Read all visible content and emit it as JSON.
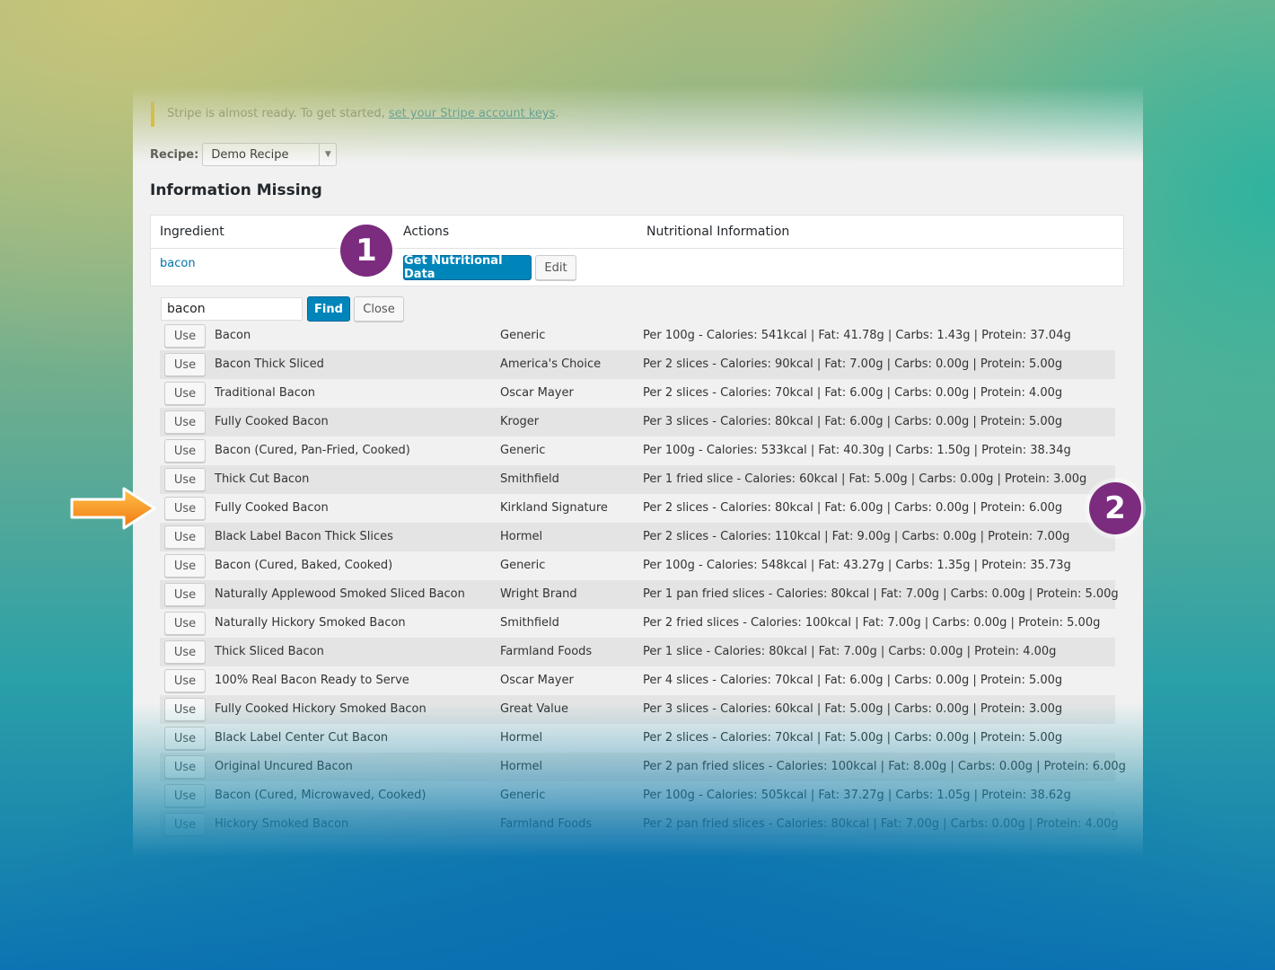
{
  "notice": {
    "text": "Stripe is almost ready. To get started, ",
    "link": "set your Stripe account keys",
    "end": "."
  },
  "recipe": {
    "label": "Recipe:",
    "selected": "Demo Recipe"
  },
  "heading": "Information Missing",
  "table": {
    "headers": [
      "Ingredient",
      "Actions",
      "Nutritional Information"
    ],
    "ingredient": "bacon",
    "get_button": "Get Nutritional Data",
    "edit_button": "Edit"
  },
  "search": {
    "value": "bacon",
    "find_label": "Find",
    "close_label": "Close"
  },
  "use_label": "Use",
  "results": [
    {
      "name": "Bacon",
      "brand": "Generic",
      "nutrition": "Per 100g - Calories: 541kcal | Fat: 41.78g | Carbs: 1.43g | Protein: 37.04g"
    },
    {
      "name": "Bacon Thick Sliced",
      "brand": "America's Choice",
      "nutrition": "Per 2 slices - Calories: 90kcal | Fat: 7.00g | Carbs: 0.00g | Protein: 5.00g"
    },
    {
      "name": "Traditional Bacon",
      "brand": "Oscar Mayer",
      "nutrition": "Per 2 slices - Calories: 70kcal | Fat: 6.00g | Carbs: 0.00g | Protein: 4.00g"
    },
    {
      "name": "Fully Cooked Bacon",
      "brand": "Kroger",
      "nutrition": "Per 3 slices - Calories: 80kcal | Fat: 6.00g | Carbs: 0.00g | Protein: 5.00g"
    },
    {
      "name": "Bacon (Cured, Pan-Fried, Cooked)",
      "brand": "Generic",
      "nutrition": "Per 100g - Calories: 533kcal | Fat: 40.30g | Carbs: 1.50g | Protein: 38.34g"
    },
    {
      "name": "Thick Cut Bacon",
      "brand": "Smithfield",
      "nutrition": "Per 1 fried slice - Calories: 60kcal | Fat: 5.00g | Carbs: 0.00g | Protein: 3.00g"
    },
    {
      "name": "Fully Cooked Bacon",
      "brand": "Kirkland Signature",
      "nutrition": "Per 2 slices - Calories: 80kcal | Fat: 6.00g | Carbs: 0.00g | Protein: 6.00g"
    },
    {
      "name": "Black Label Bacon Thick Slices",
      "brand": "Hormel",
      "nutrition": "Per 2 slices - Calories: 110kcal | Fat: 9.00g | Carbs: 0.00g | Protein: 7.00g"
    },
    {
      "name": "Bacon (Cured, Baked, Cooked)",
      "brand": "Generic",
      "nutrition": "Per 100g - Calories: 548kcal | Fat: 43.27g | Carbs: 1.35g | Protein: 35.73g"
    },
    {
      "name": "Naturally Applewood Smoked Sliced Bacon",
      "brand": "Wright Brand",
      "nutrition": "Per 1 pan fried slices - Calories: 80kcal | Fat: 7.00g | Carbs: 0.00g | Protein: 5.00g"
    },
    {
      "name": "Naturally Hickory Smoked Bacon",
      "brand": "Smithfield",
      "nutrition": "Per 2 fried slices - Calories: 100kcal | Fat: 7.00g | Carbs: 0.00g | Protein: 5.00g"
    },
    {
      "name": "Thick Sliced Bacon",
      "brand": "Farmland Foods",
      "nutrition": "Per 1 slice - Calories: 80kcal | Fat: 7.00g | Carbs: 0.00g | Protein: 4.00g"
    },
    {
      "name": "100% Real Bacon Ready to Serve",
      "brand": "Oscar Mayer",
      "nutrition": "Per 4 slices - Calories: 70kcal | Fat: 6.00g | Carbs: 0.00g | Protein: 5.00g"
    },
    {
      "name": "Fully Cooked Hickory Smoked Bacon",
      "brand": "Great Value",
      "nutrition": "Per 3 slices - Calories: 60kcal | Fat: 5.00g | Carbs: 0.00g | Protein: 3.00g"
    },
    {
      "name": "Black Label Center Cut Bacon",
      "brand": "Hormel",
      "nutrition": "Per 2 slices - Calories: 70kcal | Fat: 5.00g | Carbs: 0.00g | Protein: 5.00g"
    },
    {
      "name": "Original Uncured Bacon",
      "brand": "Hormel",
      "nutrition": "Per 2 pan fried slices - Calories: 100kcal | Fat: 8.00g | Carbs: 0.00g | Protein: 6.00g"
    },
    {
      "name": "Bacon (Cured, Microwaved, Cooked)",
      "brand": "Generic",
      "nutrition": "Per 100g - Calories: 505kcal | Fat: 37.27g | Carbs: 1.05g | Protein: 38.62g"
    },
    {
      "name": "Hickory Smoked Bacon",
      "brand": "Farmland Foods",
      "nutrition": "Per 2 pan fried slices - Calories: 80kcal | Fat: 7.00g | Carbs: 0.00g | Protein: 4.00g"
    }
  ],
  "annotations": {
    "badge1": "1",
    "badge2": "2",
    "arrow": "arrow-right-icon"
  },
  "colors": {
    "primary": "#0085ba",
    "badge": "#7b2c7e",
    "arrow": "#f7931e"
  }
}
